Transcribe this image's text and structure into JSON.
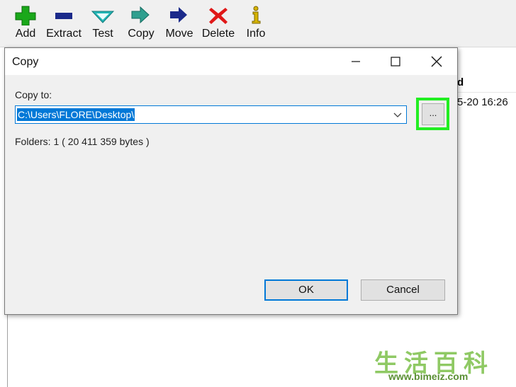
{
  "toolbar": {
    "items": [
      {
        "label": "Add",
        "icon": "plus-icon",
        "color": "#1aa81a"
      },
      {
        "label": "Extract",
        "icon": "minus-icon",
        "color": "#1b2a8a"
      },
      {
        "label": "Test",
        "icon": "check-icon",
        "color": "#22b6b6"
      },
      {
        "label": "Copy",
        "icon": "double-arrow-icon",
        "color": "#2f9f8f"
      },
      {
        "label": "Move",
        "icon": "arrow-right-icon",
        "color": "#1b2a8a"
      },
      {
        "label": "Delete",
        "icon": "x-icon",
        "color": "#e01818"
      },
      {
        "label": "Info",
        "icon": "info-icon",
        "color": "#d6b400"
      }
    ]
  },
  "list": {
    "header_fragment": "d",
    "cell_fragment": "5-20 16:26"
  },
  "dialog": {
    "title": "Copy",
    "copy_to_label": "Copy to:",
    "path_value": "C:\\Users\\FLORE\\Desktop\\",
    "browse_label": "...",
    "folders_info": "Folders: 1    ( 20 411 359 bytes )",
    "ok_label": "OK",
    "cancel_label": "Cancel"
  },
  "colors": {
    "accent": "#0078d7",
    "highlight": "#22ee22"
  },
  "watermark": {
    "chars": "生活百科",
    "url": "www.bimeiz.com"
  }
}
